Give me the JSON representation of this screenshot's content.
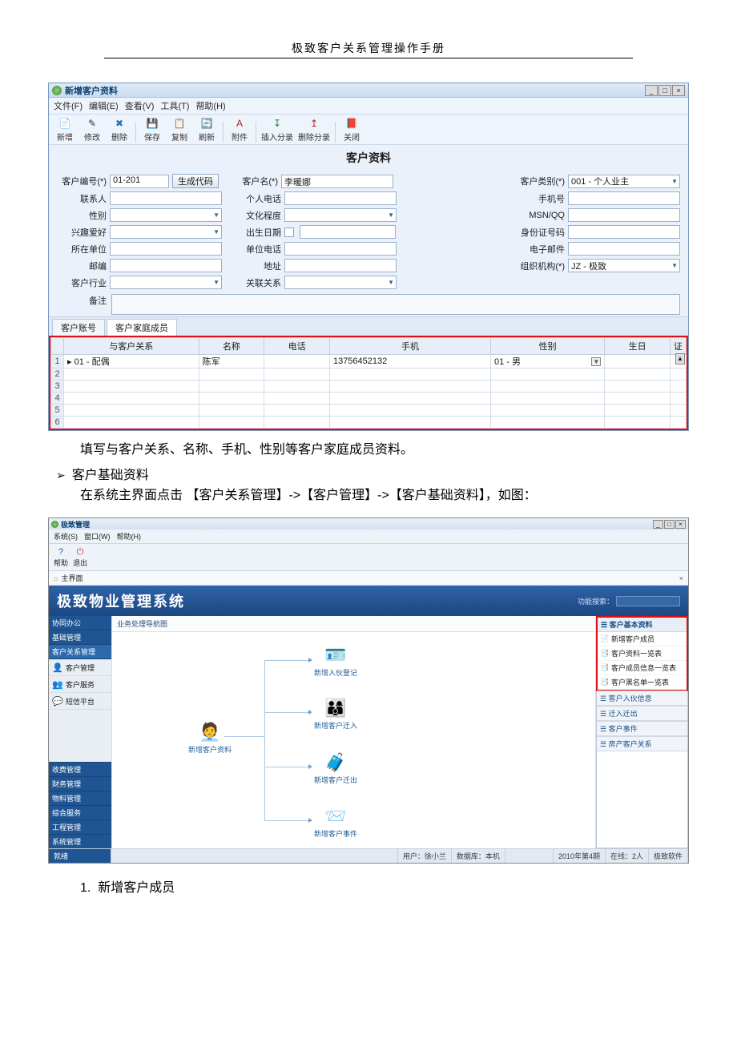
{
  "page_header": "极致客户关系管理操作手册",
  "dialog": {
    "title": "新增客户资料",
    "menu": {
      "file": "文件(F)",
      "edit": "编辑(E)",
      "view": "查看(V)",
      "tool": "工具(T)",
      "help": "帮助(H)"
    },
    "toolbar": {
      "new": "新增",
      "modify": "修改",
      "delete": "删除",
      "save": "保存",
      "copy": "复制",
      "refresh": "刷新",
      "attach": "附件",
      "insert_row": "插入分录",
      "delete_row": "删除分录",
      "close": "关闭"
    },
    "form_title": "客户资料",
    "labels": {
      "cust_no": "客户编号(*)",
      "gen_code": "生成代码",
      "cust_name": "客户名(*)",
      "cust_type": "客户类别(*)",
      "contact": "联系人",
      "personal_phone": "个人电话",
      "mobile": "手机号",
      "gender": "性别",
      "education": "文化程度",
      "msnqq": "MSN/QQ",
      "hobby": "兴趣爱好",
      "birth": "出生日期",
      "idcard": "身份证号码",
      "company": "所在单位",
      "company_phone": "单位电话",
      "email": "电子邮件",
      "postcode": "邮编",
      "address": "地址",
      "org": "组织机构(*)",
      "industry": "客户行业",
      "relation": "关联关系",
      "remark": "备注"
    },
    "values": {
      "cust_no": "01-201",
      "cust_name": "李暖娜",
      "cust_type": "001 - 个人业主",
      "org": "JZ - 极致"
    },
    "tabs": {
      "t1": "客户账号",
      "t2": "客户家庭成员"
    },
    "grid": {
      "cols": {
        "rel": "与客户关系",
        "name": "名称",
        "phone": "电话",
        "mobile": "手机",
        "gender": "性别",
        "birthday": "生日",
        "id": "证"
      },
      "rows": [
        {
          "n": "1",
          "rel": "01 - 配偶",
          "name": "陈军",
          "phone": "",
          "mobile": "13756452132",
          "gender": "01 - 男",
          "birthday": ""
        }
      ]
    }
  },
  "body_text_1": "填写与客户关系、名称、手机、性别等客户家庭成员资料。",
  "bullet_label": "客户基础资料",
  "body_text_2": "在系统主界面点击 【客户关系管理】->【客户管理】->【客户基础资料】，如图：",
  "sys": {
    "title": "极致管理",
    "menu": {
      "sys": "系统(S)",
      "win": "窗口(W)",
      "help": "帮助(H)"
    },
    "tb": {
      "help": "帮助",
      "exit": "退出"
    },
    "crumb_home": "主界面",
    "hero": "极致物业管理系统",
    "search_label": "功能搜索：",
    "lnav_top": [
      "协同办公",
      "基础管理",
      "客户关系管理"
    ],
    "lnav_items": {
      "i1": "客户管理",
      "i2": "客户服务",
      "i3": "短信平台"
    },
    "lnav_bottom": [
      "收费管理",
      "财务管理",
      "物料管理",
      "综合服务",
      "工程管理",
      "系统管理"
    ],
    "canvas_head": "业务处理导航图",
    "nodes": {
      "root": "新增客户资料",
      "a": "新增入伙登记",
      "b": "新增客户迁入",
      "c": "新增客户迁出",
      "d": "新增客户事件"
    },
    "rnav": {
      "h1": "客户基本资料",
      "items1": [
        "新增客户成员",
        "客户资料一览表",
        "客户成员信息一览表",
        "客户黑名单一览表"
      ],
      "h2": "客户入伙信息",
      "h3": "迁入迁出",
      "h4": "客户事件",
      "h5": "房产客户关系"
    },
    "status": {
      "ready": "就绪",
      "user": "用户：徐小兰",
      "db": "数据库：本机",
      "period": "2010年第4期",
      "online": "在线：2人",
      "corp": "极致软件"
    }
  },
  "number_item": "新增客户成员"
}
